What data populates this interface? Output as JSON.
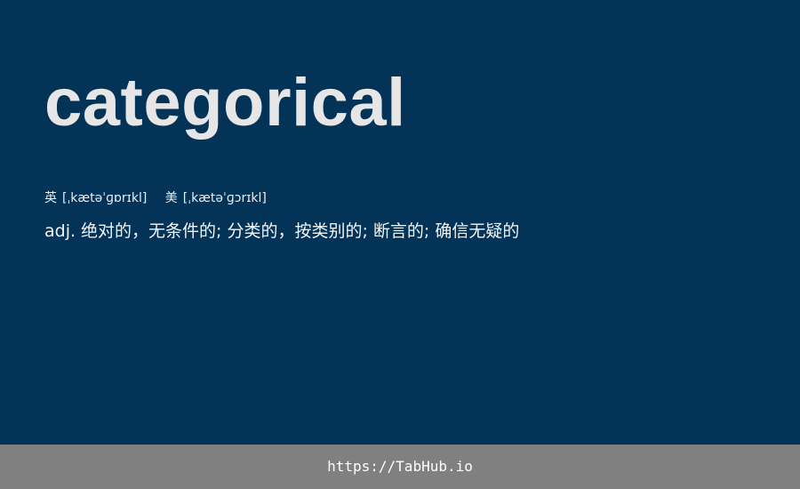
{
  "entry": {
    "word": "categorical",
    "phonetics": {
      "uk_label": "英",
      "uk": "[ˌkætəˈɡɒrɪkl]",
      "us_label": "美",
      "us": "[ˌkætəˈɡɔrɪkl]"
    },
    "definition": {
      "pos": "adj.",
      "meaning": "绝对的，无条件的; 分类的，按类别的; 断言的; 确信无疑的"
    }
  },
  "footer": {
    "url": "https://TabHub.io"
  },
  "colors": {
    "background": "#033357",
    "footer_background": "#808080",
    "word_text": "#e6e6e6",
    "body_text": "#f2f5f8"
  }
}
